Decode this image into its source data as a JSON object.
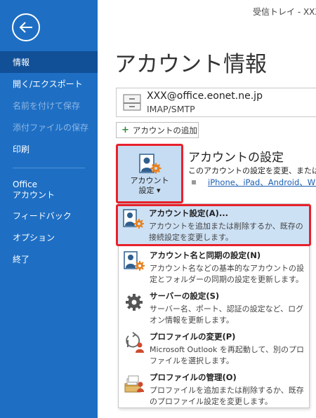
{
  "window": {
    "title": "受信トレイ - XXX"
  },
  "sidebar": {
    "items": [
      {
        "label": "情報"
      },
      {
        "label": "開く/エクスポート"
      },
      {
        "label": "名前を付けて保存"
      },
      {
        "label": "添付ファイルの保存"
      },
      {
        "label": "印刷"
      },
      {
        "line1": "Office",
        "line2": "アカウント"
      },
      {
        "label": "フィードバック"
      },
      {
        "label": "オプション"
      },
      {
        "label": "終了"
      }
    ]
  },
  "main": {
    "title": "アカウント情報",
    "account": {
      "email": "XXX@office.eonet.ne.jp",
      "type": "IMAP/SMTP"
    },
    "add_account_label": "アカウントの追加",
    "settings_button": {
      "line1": "アカウント",
      "line2": "設定 ▾"
    },
    "settings_section": {
      "title": "アカウントの設定",
      "desc": "このアカウントの設定を変更、または追",
      "link": "iPhone、iPad、Android、Win"
    }
  },
  "menu": {
    "items": [
      {
        "title": "アカウント設定(A)...",
        "desc": "アカウントを追加または削除するか、既存の接続設定を変更します。",
        "icon": "account-settings-icon"
      },
      {
        "title": "アカウント名と同期の設定(N)",
        "desc": "アカウント名などの基本的なアカウントの設定とフォルダーの同期の設定を更新します。",
        "icon": "account-sync-icon"
      },
      {
        "title": "サーバーの設定(S)",
        "desc": "サーバー名、ポート、認証の設定など、ログオン情報を更新します。",
        "icon": "gear-icon"
      },
      {
        "title": "プロファイルの変更(P)",
        "desc": "Microsoft Outlook を再起動して、別のプロファイルを選択します。",
        "icon": "profile-change-icon"
      },
      {
        "title": "プロファイルの管理(O)",
        "desc": "プロファイルを追加または削除するか、既存のプロファイル設定を変更します。",
        "icon": "profile-manage-icon"
      }
    ]
  },
  "colors": {
    "sidebar": "#1e6fc4",
    "sidebar_active": "#114f97",
    "highlight_border": "#e8212b",
    "accent_orange": "#e8821e"
  }
}
